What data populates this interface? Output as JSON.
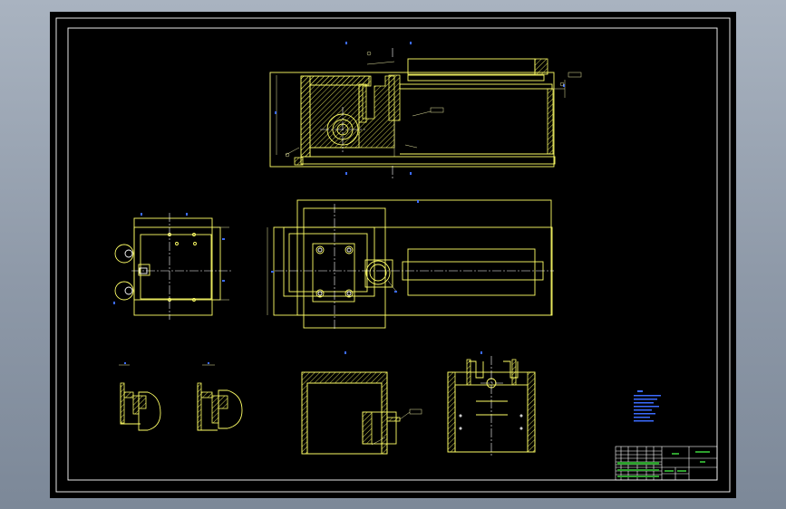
{
  "drawing": {
    "colors": {
      "background": "#000000",
      "outline": "#ffff66",
      "centerline": "#ffffff",
      "dimension_markers": "#3b6bff",
      "title_block_cells": "#2ea02e"
    },
    "views": [
      "front-section-view",
      "top-view",
      "side-view",
      "detail-view-a",
      "detail-view-b",
      "base-section-view",
      "end-section-view"
    ],
    "technical_notes_legible": false,
    "title_block_legible": false
  }
}
